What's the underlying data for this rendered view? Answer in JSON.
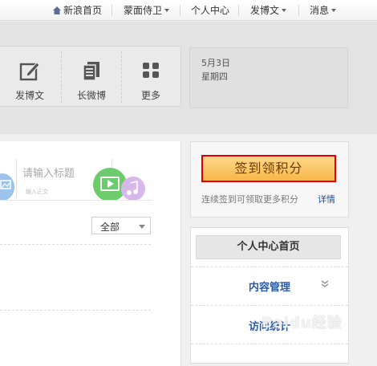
{
  "topnav": {
    "items": [
      {
        "label": "新浪首页",
        "icon": "home-icon"
      },
      {
        "label": "蒙面侍卫",
        "dropdown": true
      },
      {
        "label": "个人中心"
      },
      {
        "label": "发博文",
        "dropdown": true
      },
      {
        "label": "消息",
        "dropdown": true
      }
    ]
  },
  "tools": [
    {
      "label": "发博文",
      "icon": "edit-icon"
    },
    {
      "label": "长微博",
      "icon": "long-weibo-icon"
    },
    {
      "label": "更多",
      "icon": "grid-icon"
    }
  ],
  "date": {
    "day": "5月3日",
    "weekday": "星期四"
  },
  "composer": {
    "title_placeholder": "请输入标题",
    "body_placeholder": "输入正文",
    "media_icons": [
      "image-icon",
      "video-icon",
      "music-icon"
    ]
  },
  "filter": {
    "selected": "全部"
  },
  "signin": {
    "button": "签到领积分",
    "tip": "连续签到可领取更多积分",
    "detail": "详情"
  },
  "menu": {
    "header": "个人中心首页",
    "items": [
      {
        "label": "内容管理",
        "expand_icon": "double-chevron-down-icon"
      },
      {
        "label": "访问统计"
      }
    ]
  },
  "watermark": "Baidu经验",
  "colors": {
    "signin_border": "#e00000",
    "signin_fill": "#f7b648",
    "menu_link": "#2a5aa8",
    "video_green": "#6ccb6c"
  }
}
